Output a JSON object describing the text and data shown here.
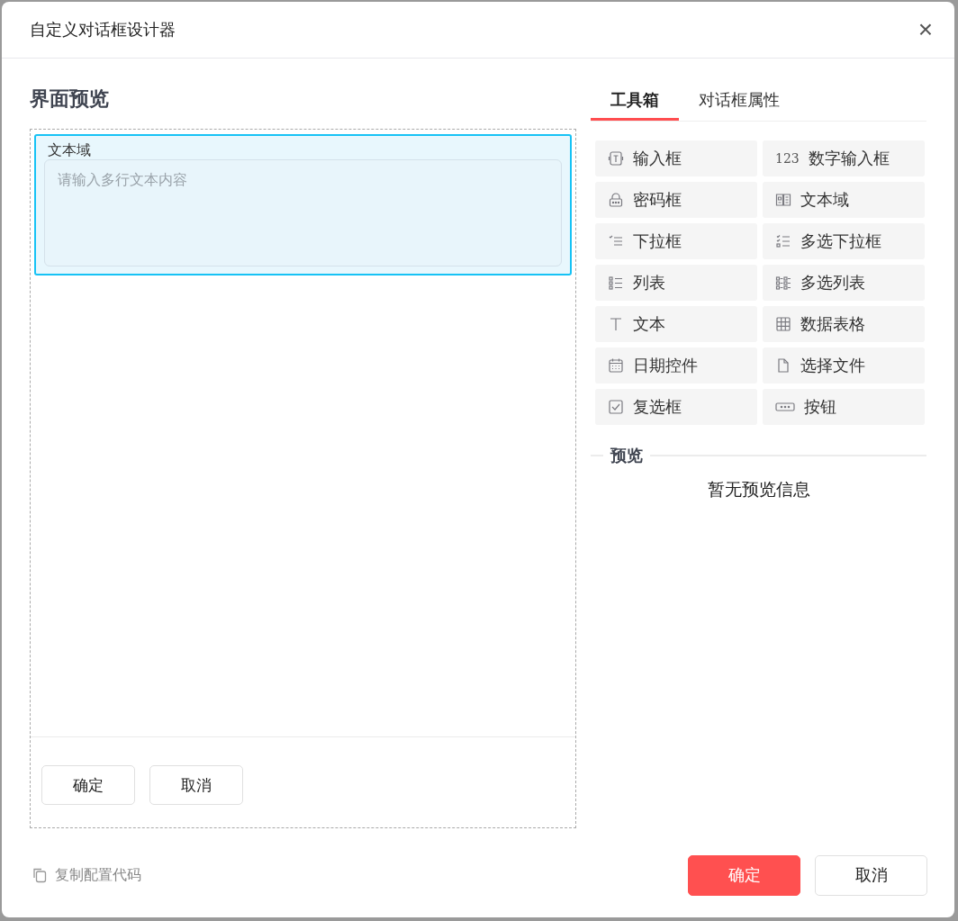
{
  "window": {
    "title": "自定义对话框设计器",
    "close": "×"
  },
  "preview_panel": {
    "title": "界面预览",
    "fields": [
      {
        "kind": "textarea",
        "label": "文本域",
        "placeholder": "请输入多行文本内容",
        "selected": true
      }
    ],
    "buttons": [
      {
        "label": "确定"
      },
      {
        "label": "取消"
      }
    ]
  },
  "tabs": [
    {
      "label": "工具箱",
      "selected": true
    },
    {
      "label": "对话框属性",
      "selected": false
    }
  ],
  "tools": [
    {
      "kind": "input",
      "label": "输入框"
    },
    {
      "kind": "number",
      "label": "数字输入框",
      "icon_text": "123"
    },
    {
      "kind": "password",
      "label": "密码框"
    },
    {
      "kind": "textarea",
      "label": "文本域"
    },
    {
      "kind": "select",
      "label": "下拉框"
    },
    {
      "kind": "multiselect",
      "label": "多选下拉框"
    },
    {
      "kind": "list",
      "label": "列表"
    },
    {
      "kind": "multilist",
      "label": "多选列表"
    },
    {
      "kind": "text",
      "label": "文本"
    },
    {
      "kind": "table",
      "label": "数据表格"
    },
    {
      "kind": "date",
      "label": "日期控件"
    },
    {
      "kind": "file",
      "label": "选择文件"
    },
    {
      "kind": "checkbox",
      "label": "复选框"
    },
    {
      "kind": "button",
      "label": "按钮"
    }
  ],
  "preview": {
    "title": "预览",
    "message": "暂无预览信息"
  },
  "footer": {
    "copy_link": "复制配置代码",
    "buttons": [
      {
        "kind": "primary",
        "label": "确定"
      },
      {
        "kind": "default",
        "label": "取消"
      }
    ]
  }
}
